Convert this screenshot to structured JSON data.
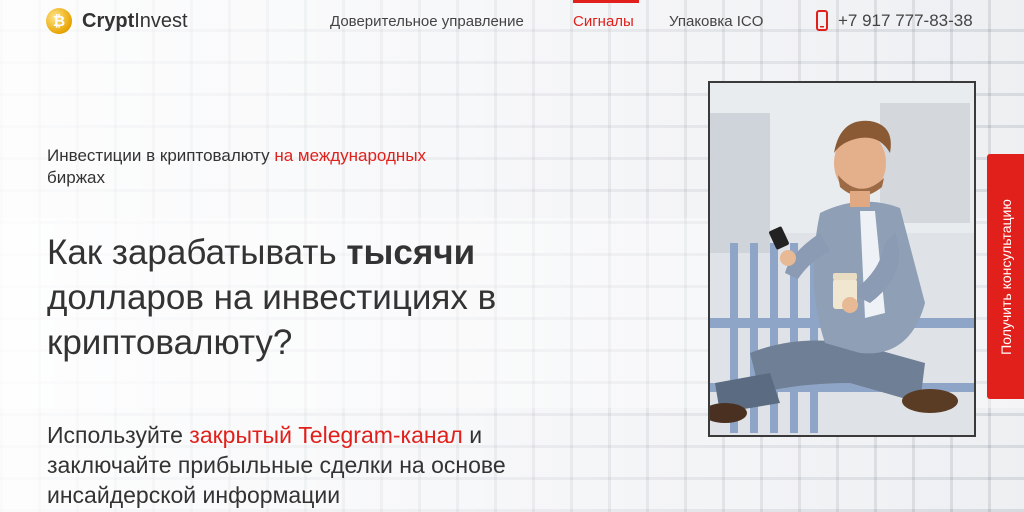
{
  "brand": {
    "name_bold": "Crypt",
    "name_regular": "Invest",
    "coin_symbol": "₿"
  },
  "nav": {
    "items": [
      "Доверительное управление",
      "Сигналы",
      "Упаковка ICO"
    ],
    "active_index": 1
  },
  "phone": {
    "number": "+7 917 777-83-38"
  },
  "hero": {
    "subtitle_plain": "Инвестиции в криптовалюту ",
    "subtitle_red": "на международных",
    "subtitle_end": "биржах",
    "headline_before": "Как зарабатывать ",
    "headline_bold": "тысячи",
    "headline_after": "долларов на инвестициях в криптовалюту?",
    "para_before": "Используйте ",
    "para_red": "закрытый Telegram-канал",
    "para_after": " и заключайте прибыльные сделки на основе инсайдерской информации"
  },
  "consult_button": {
    "label": "Получить консультацию"
  },
  "colors": {
    "accent": "#e1201c",
    "text": "#333333",
    "coin": "#e8a400"
  },
  "icons": {
    "logo": "bitcoin-coin-icon",
    "phone": "mobile-phone-icon"
  }
}
